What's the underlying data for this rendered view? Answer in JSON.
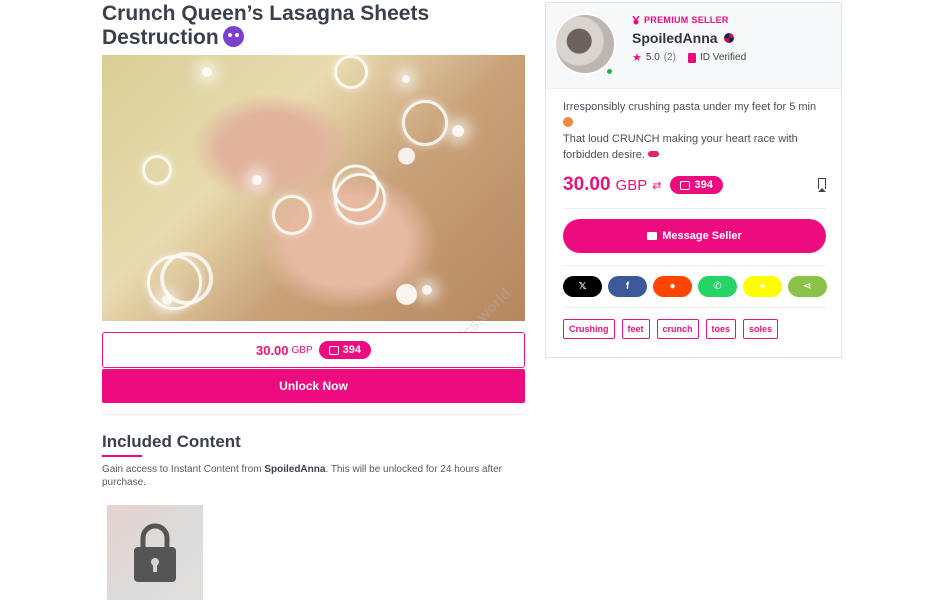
{
  "product": {
    "title": "Crunch Queen’s Lasagna Sheets Destruction",
    "price_amount": "30.00",
    "price_currency": "GBP",
    "coins": "394",
    "unlock_label": "Unlock Now",
    "watermark": "FeetPics.world"
  },
  "included": {
    "heading": "Included Content",
    "desc_prefix": "Gain access to Instant Content from ",
    "desc_seller": "SpoiledAnna",
    "desc_suffix": ". This will be unlocked for 24 hours after purchase."
  },
  "seller": {
    "badge": "PREMIUM SELLER",
    "name": "SpoiledAnna",
    "rating": "5.0",
    "rating_count": "(2)",
    "verified": "ID Verified",
    "description_line1": "Irresponsibly crushing pasta under my feet for 5 min",
    "description_line2": "That loud CRUNCH making your heart race with forbidden desire.",
    "price_amount": "30.00",
    "price_currency": "GBP",
    "coins": "394",
    "message_label": "Message Seller"
  },
  "share_buttons": [
    {
      "label": "𝕏",
      "icon": "x-icon",
      "color": "#000000"
    },
    {
      "label": "f",
      "icon": "facebook-icon",
      "color": "#3b5998"
    },
    {
      "label": "●",
      "icon": "reddit-icon",
      "color": "#ff4500"
    },
    {
      "label": "✆",
      "icon": "whatsapp-icon",
      "color": "#25d366"
    },
    {
      "label": "●",
      "icon": "snapchat-icon",
      "color": "#fffc00"
    },
    {
      "label": "⋖",
      "icon": "share-icon",
      "color": "#8bc34a"
    }
  ],
  "tags": [
    "Crushing",
    "feet",
    "crunch",
    "toes",
    "soles"
  ],
  "colors": {
    "accent": "#ed0c7f"
  }
}
